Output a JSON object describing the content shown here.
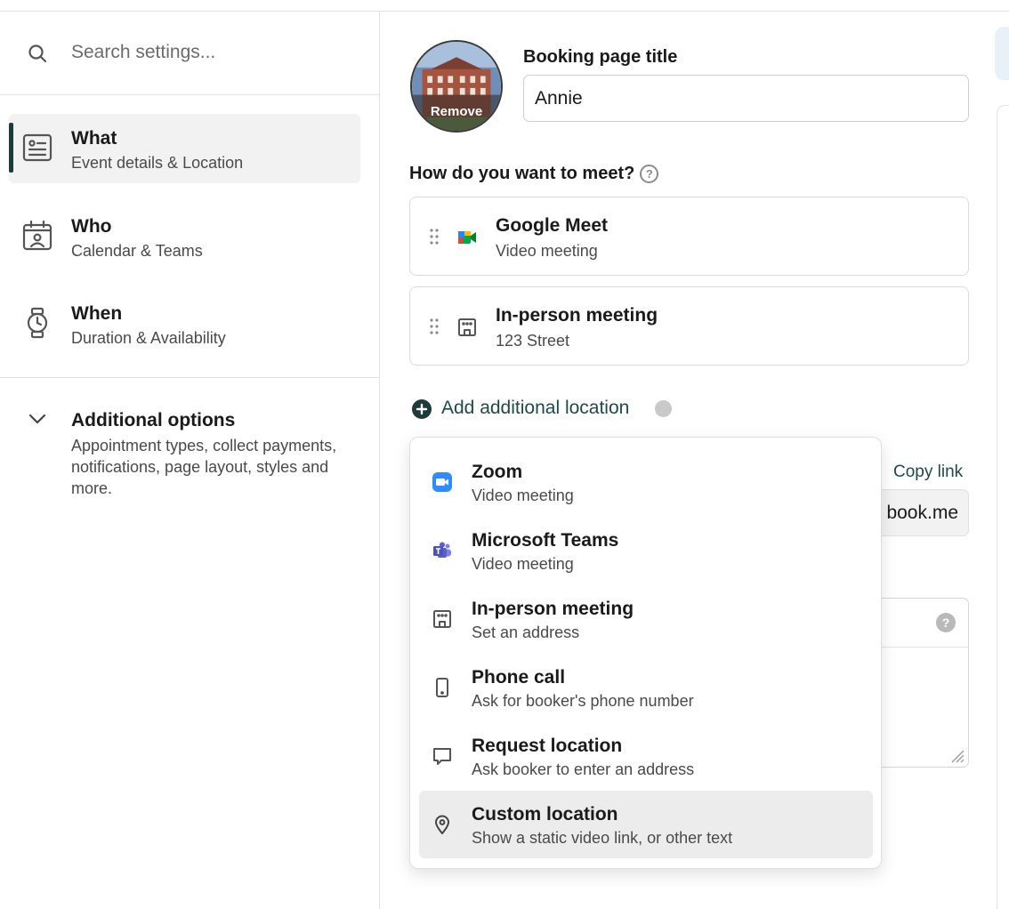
{
  "search": {
    "placeholder": "Search settings..."
  },
  "sidebar": {
    "items": [
      {
        "title": "What",
        "subtitle": "Event details & Location"
      },
      {
        "title": "Who",
        "subtitle": "Calendar & Teams"
      },
      {
        "title": "When",
        "subtitle": "Duration & Availability"
      }
    ],
    "additional": {
      "title": "Additional options",
      "description": "Appointment types, collect payments, notifications, page layout, styles and more."
    }
  },
  "main": {
    "avatar_remove": "Remove",
    "booking_title_label": "Booking page title",
    "booking_title_value": "Annie",
    "meet_question": "How do you want to meet?",
    "help_glyph": "?",
    "locations": [
      {
        "title": "Google Meet",
        "subtitle": "Video meeting"
      },
      {
        "title": "In-person meeting",
        "subtitle": "123 Street"
      }
    ],
    "add_location": "Add additional location",
    "copy_link": "Copy link",
    "link_value": "book.me",
    "desc_help": "?"
  },
  "dropdown": {
    "options": [
      {
        "title": "Zoom",
        "subtitle": "Video meeting"
      },
      {
        "title": "Microsoft Teams",
        "subtitle": "Video meeting"
      },
      {
        "title": "In-person meeting",
        "subtitle": "Set an address"
      },
      {
        "title": "Phone call",
        "subtitle": "Ask for booker's phone number"
      },
      {
        "title": "Request location",
        "subtitle": "Ask booker to enter an address"
      },
      {
        "title": "Custom location",
        "subtitle": "Show a static video link, or other text"
      }
    ],
    "highlighted": "Custom location"
  },
  "colors": {
    "accent": "#1d4a48",
    "active_bar": "#1d3b3a",
    "zoom_blue": "#2d8cff",
    "teams_purple": "#5b5fc7"
  }
}
